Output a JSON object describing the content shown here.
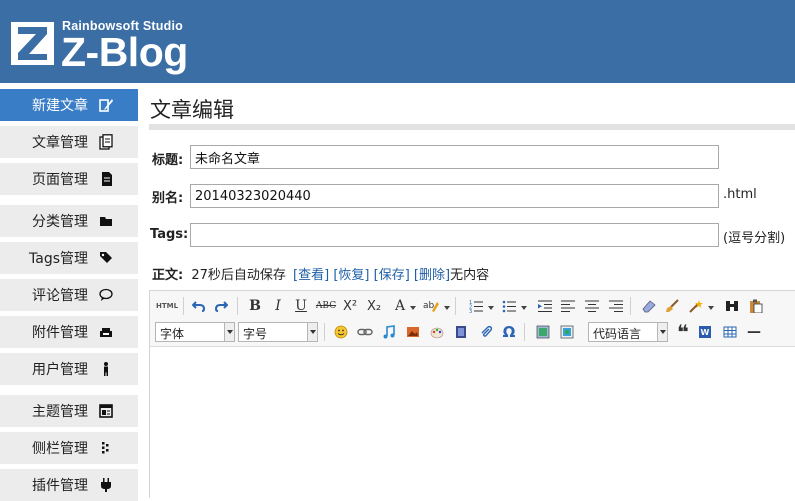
{
  "header": {
    "studio": "Rainbowsoft Studio",
    "brand": "Z-Blog",
    "logo_letter": "Z",
    "bg_color": "#3a6ea5"
  },
  "sidebar": {
    "items": [
      {
        "label": "新建文章",
        "icon": "edit-icon",
        "active": true
      },
      {
        "label": "文章管理",
        "icon": "documents-icon"
      },
      {
        "label": "页面管理",
        "icon": "page-icon"
      },
      {
        "label": "分类管理",
        "icon": "folder-icon"
      },
      {
        "label": "Tags管理",
        "icon": "tag-icon"
      },
      {
        "label": "评论管理",
        "icon": "comment-icon"
      },
      {
        "label": "附件管理",
        "icon": "attachment-icon"
      },
      {
        "label": "用户管理",
        "icon": "user-icon"
      },
      {
        "label": "主题管理",
        "icon": "theme-icon"
      },
      {
        "label": "侧栏管理",
        "icon": "sidebar-icon"
      },
      {
        "label": "插件管理",
        "icon": "plugin-icon"
      }
    ],
    "active_color": "#3a7dc7"
  },
  "main": {
    "title": "文章编辑",
    "fields": {
      "title_label": "标题:",
      "title_value": "未命名文章",
      "alias_label": "别名:",
      "alias_value": "20140323020440",
      "alias_suffix": ".html",
      "tags_label": "Tags:",
      "tags_value": "",
      "tags_hint": "(逗号分割)"
    },
    "content": {
      "label": "正文:",
      "autosave": "27秒后自动保存",
      "view": "[查看]",
      "restore": "[恢复]",
      "save": "[保存]",
      "delete": "[删除]",
      "status": "无内容"
    }
  },
  "editor": {
    "toolbar": {
      "html_label": "HTML",
      "bold": "B",
      "italic": "I",
      "underline": "U",
      "strike": "ABC",
      "superscript": "X²",
      "subscript": "X₂",
      "fontcolor": "A",
      "font_family": "字体",
      "font_size": "字号",
      "code_lang": "代码语言",
      "quote": "❝",
      "hr": "—",
      "omega": "Ω"
    }
  }
}
